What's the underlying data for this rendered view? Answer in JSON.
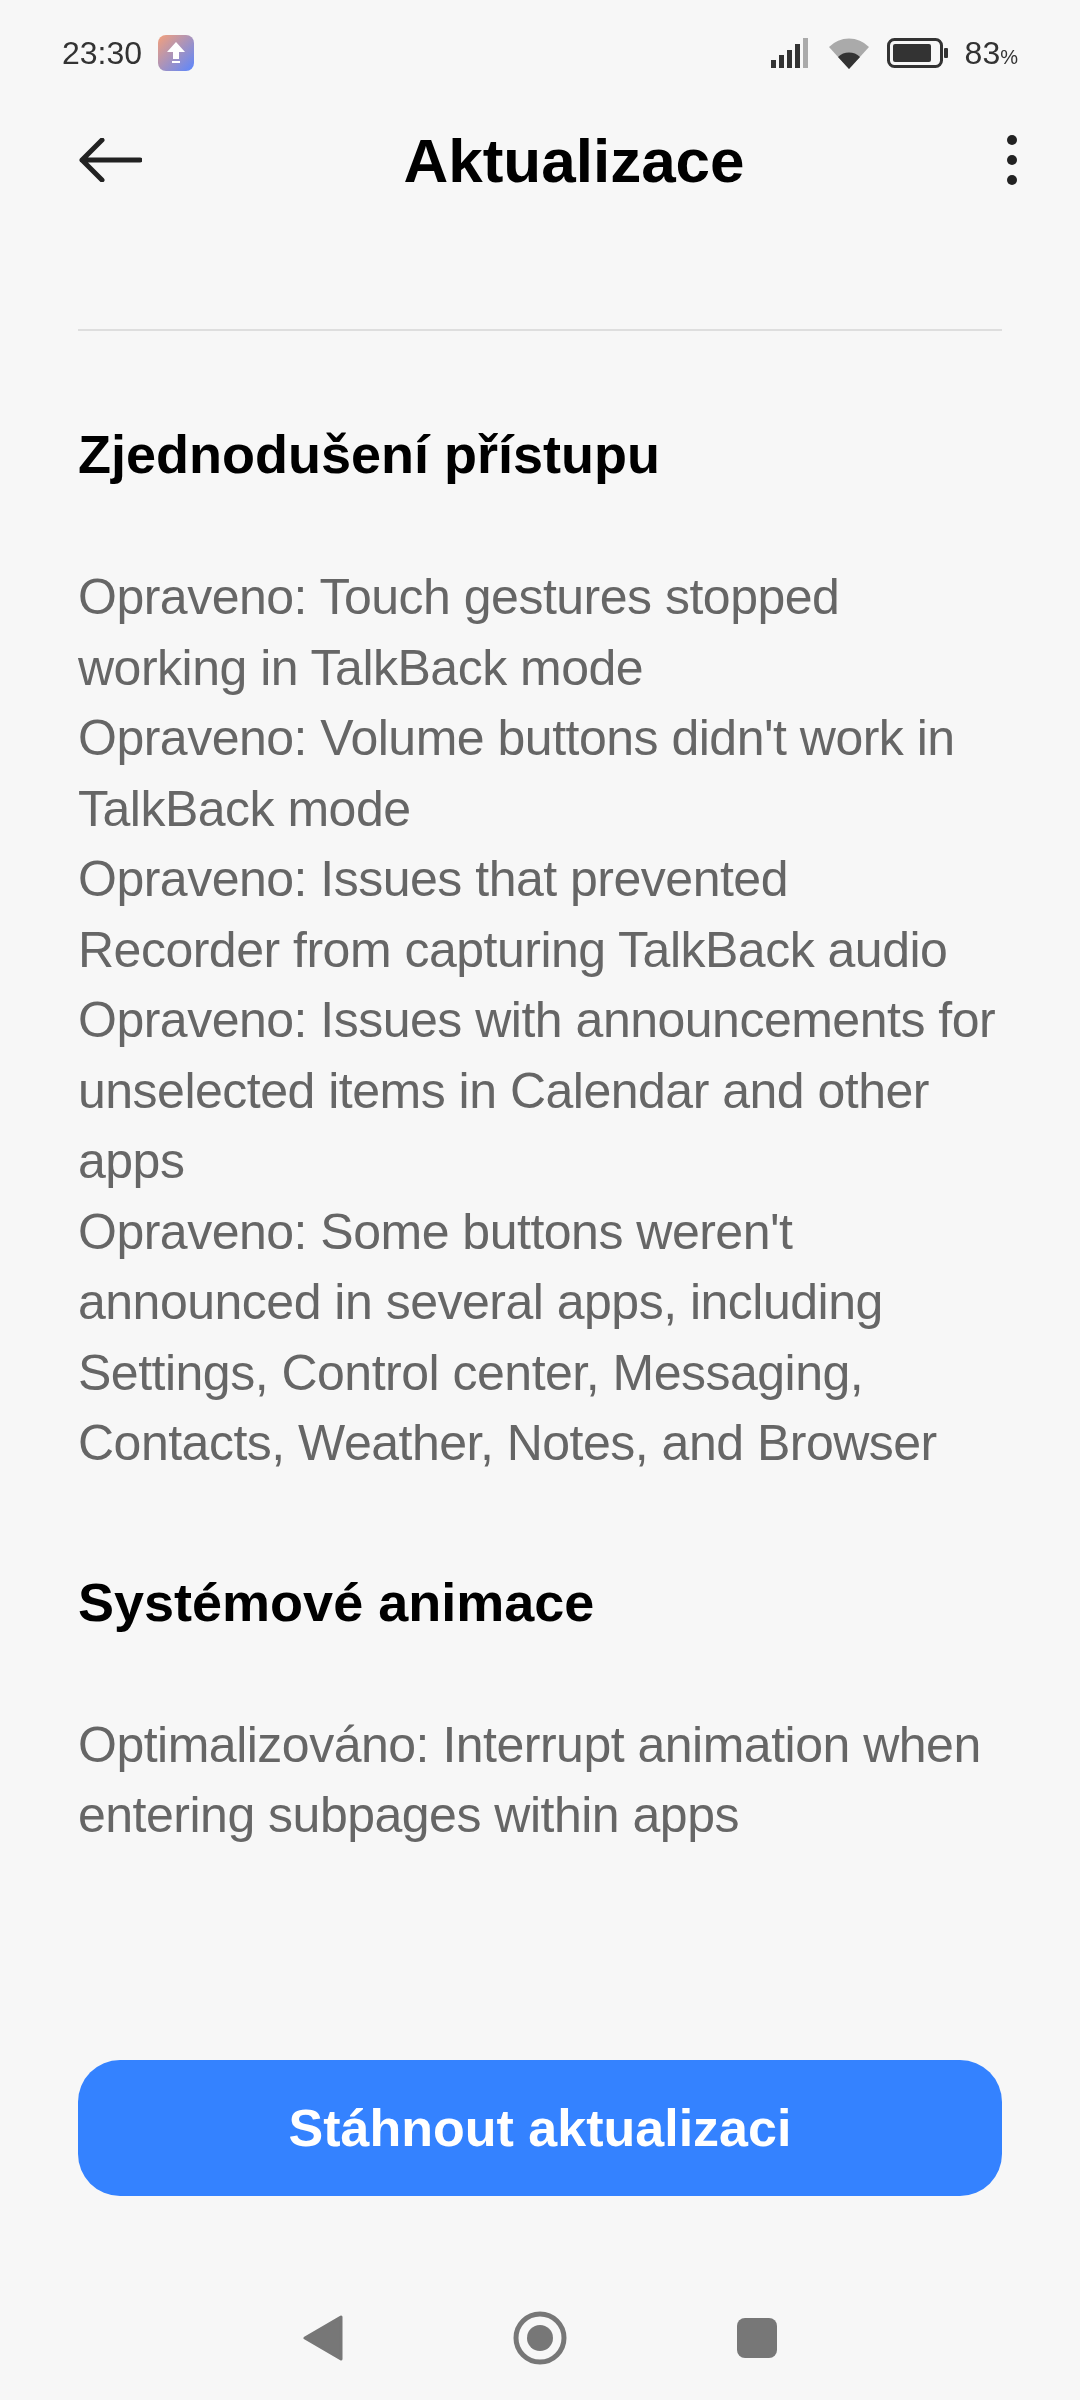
{
  "status_bar": {
    "time": "23:30",
    "battery": "83",
    "battery_unit": "%"
  },
  "header": {
    "title": "Aktualizace"
  },
  "sections": [
    {
      "heading": "Zjednodušení přístupu",
      "items": [
        "Opraveno: Touch gestures stopped working in TalkBack mode",
        "Opraveno: Volume buttons didn't work in TalkBack mode",
        "Opraveno: Issues that prevented Recorder from capturing TalkBack audio",
        "Opraveno: Issues with announcements for unselected items in Calendar and other apps",
        "Opraveno: Some buttons weren't announced in several apps, including Settings, Control center, Messaging, Contacts, Weather, Notes, and Browser"
      ]
    },
    {
      "heading": "Systémové animace",
      "items": [
        "Optimalizováno: Interrupt animation when entering subpages within apps"
      ]
    }
  ],
  "download_button": {
    "label": "Stáhnout aktualizaci"
  }
}
